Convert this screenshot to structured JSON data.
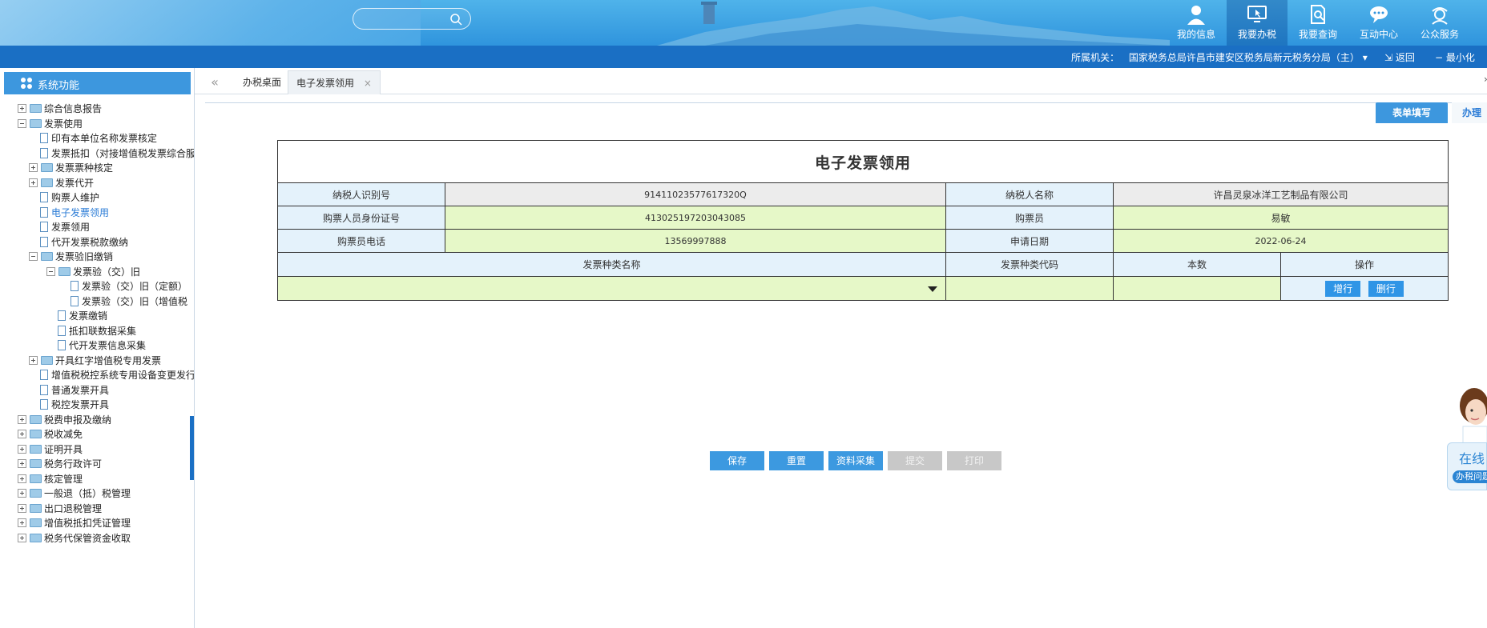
{
  "header": {
    "search_placeholder": "",
    "nav": [
      {
        "label": "我的信息",
        "icon": "user-icon",
        "active": false
      },
      {
        "label": "我要办税",
        "icon": "monitor-icon",
        "active": true
      },
      {
        "label": "我要查询",
        "icon": "search-doc-icon",
        "active": false
      },
      {
        "label": "互动中心",
        "icon": "chat-icon",
        "active": false
      },
      {
        "label": "公众服务",
        "icon": "service-icon",
        "active": false
      }
    ]
  },
  "subbar": {
    "org_label": "所属机关：",
    "org_name": "国家税务总局许昌市建安区税务局新元税务分局（主）",
    "back_label": "返回",
    "minimize_label": "最小化"
  },
  "sidebar": {
    "title": "系统功能",
    "items": [
      {
        "label": "综合信息报告",
        "type": "folder",
        "expand": "plus",
        "level": 0
      },
      {
        "label": "发票使用",
        "type": "folder",
        "expand": "minus",
        "level": 0
      },
      {
        "label": "印有本单位名称发票核定",
        "type": "doc",
        "level": 1
      },
      {
        "label": "发票抵扣（对接增值税发票综合服",
        "type": "doc",
        "level": 1
      },
      {
        "label": "发票票种核定",
        "type": "folder",
        "expand": "plus",
        "level": 1
      },
      {
        "label": "发票代开",
        "type": "folder",
        "expand": "plus",
        "level": 1
      },
      {
        "label": "购票人维护",
        "type": "doc",
        "level": 1
      },
      {
        "label": "电子发票领用",
        "type": "doc",
        "level": 1,
        "selected": true
      },
      {
        "label": "发票领用",
        "type": "doc",
        "level": 1
      },
      {
        "label": "代开发票税款缴纳",
        "type": "doc",
        "level": 1
      },
      {
        "label": "发票验旧缴销",
        "type": "folder",
        "expand": "minus",
        "level": 1
      },
      {
        "label": "发票验（交）旧",
        "type": "folder",
        "expand": "minus",
        "level": 2
      },
      {
        "label": "发票验（交）旧（定额）",
        "type": "doc",
        "level": 3
      },
      {
        "label": "发票验（交）旧（增值税",
        "type": "doc",
        "level": 3
      },
      {
        "label": "发票缴销",
        "type": "doc",
        "level": 2
      },
      {
        "label": "抵扣联数据采集",
        "type": "doc",
        "level": 2
      },
      {
        "label": "代开发票信息采集",
        "type": "doc",
        "level": 2
      },
      {
        "label": "开具红字增值税专用发票",
        "type": "folder",
        "expand": "plus",
        "level": 1
      },
      {
        "label": "增值税税控系统专用设备变更发行",
        "type": "doc",
        "level": 1
      },
      {
        "label": "普通发票开具",
        "type": "doc",
        "level": 1
      },
      {
        "label": "税控发票开具",
        "type": "doc",
        "level": 1
      },
      {
        "label": "税费申报及缴纳",
        "type": "folder",
        "expand": "plus",
        "level": 0
      },
      {
        "label": "税收减免",
        "type": "folder",
        "expand": "plus",
        "level": 0
      },
      {
        "label": "证明开具",
        "type": "folder",
        "expand": "plus",
        "level": 0
      },
      {
        "label": "税务行政许可",
        "type": "folder",
        "expand": "plus",
        "level": 0
      },
      {
        "label": "核定管理",
        "type": "folder",
        "expand": "plus",
        "level": 0
      },
      {
        "label": "一般退（抵）税管理",
        "type": "folder",
        "expand": "plus",
        "level": 0
      },
      {
        "label": "出口退税管理",
        "type": "folder",
        "expand": "plus",
        "level": 0
      },
      {
        "label": "增值税抵扣凭证管理",
        "type": "folder",
        "expand": "plus",
        "level": 0
      },
      {
        "label": "税务代保管资金收取",
        "type": "folder",
        "expand": "plus",
        "level": 0
      }
    ]
  },
  "tabs": [
    {
      "label": "办税桌面",
      "active": false
    },
    {
      "label": "电子发票领用",
      "active": true,
      "close": "×"
    }
  ],
  "content_tabs": [
    {
      "label": "表单填写",
      "active": true
    },
    {
      "label": "办理",
      "active": false
    }
  ],
  "form": {
    "title": "电子发票领用",
    "rows": [
      {
        "l1": "纳税人识别号",
        "v1": "91411023577617320Q",
        "l2": "纳税人名称",
        "v2": "许昌灵泉冰洋工艺制品有限公司"
      },
      {
        "l1": "购票人员身份证号",
        "v1": "413025197203043085",
        "l2": "购票员",
        "v2": "易敏"
      },
      {
        "l1": "购票员电话",
        "v1": "13569997888",
        "l2": "申请日期",
        "v2": "2022-06-24"
      }
    ],
    "columns": [
      "发票种类名称",
      "发票种类代码",
      "本数",
      "操作"
    ],
    "add_row_label": "增行",
    "delete_row_label": "删行"
  },
  "actions": [
    {
      "label": "保存",
      "enabled": true
    },
    {
      "label": "重置",
      "enabled": true
    },
    {
      "label": "资料采集",
      "enabled": true
    },
    {
      "label": "提交",
      "enabled": false
    },
    {
      "label": "打印",
      "enabled": false
    }
  ],
  "helper": {
    "title": "在线",
    "subtitle": "办税问题"
  },
  "colors": {
    "header_blue": "#2f94dd",
    "subbar_blue": "#1a6fc4",
    "label_bg": "#e4f2fb",
    "value_bg": "#e6f8c8",
    "button_blue": "#3c99e0"
  }
}
